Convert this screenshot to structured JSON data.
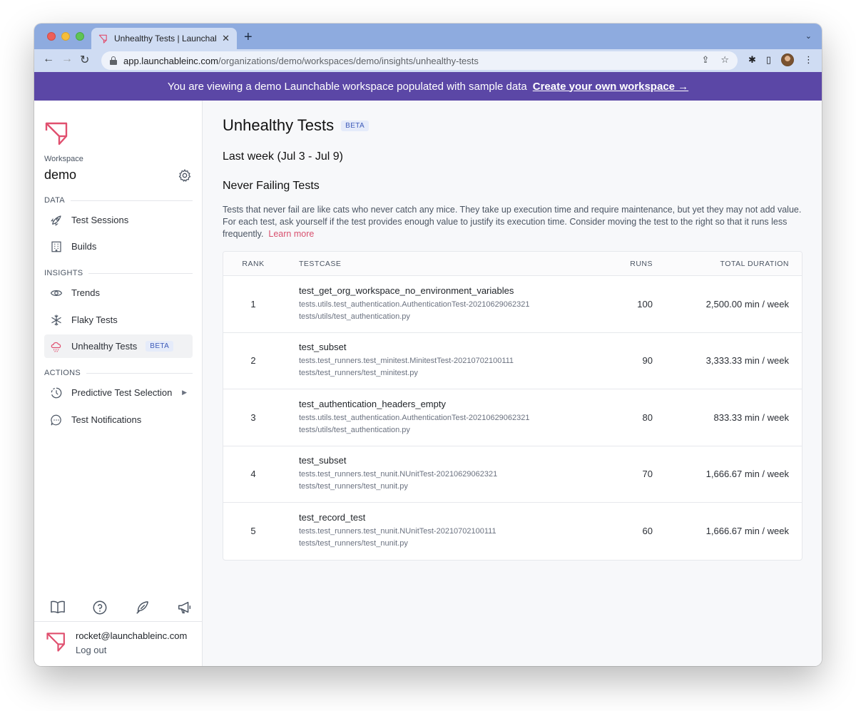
{
  "browser": {
    "tab_title": "Unhealthy Tests | Launchable",
    "new_tab": "+",
    "url_host": "app.launchableinc.com",
    "url_path": "/organizations/demo/workspaces/demo/insights/unhealthy-tests"
  },
  "banner": {
    "text": "You are viewing a demo Launchable workspace populated with sample data",
    "link": "Create your own workspace →"
  },
  "sidebar": {
    "workspace_label": "Workspace",
    "workspace_name": "demo",
    "sections": {
      "data": "DATA",
      "insights": "INSIGHTS",
      "actions": "ACTIONS"
    },
    "items": [
      {
        "label": "Test Sessions",
        "icon": "rocket-icon"
      },
      {
        "label": "Builds",
        "icon": "building-icon"
      },
      {
        "label": "Trends",
        "icon": "eye-icon"
      },
      {
        "label": "Flaky Tests",
        "icon": "snowflake-icon"
      },
      {
        "label": "Unhealthy Tests",
        "icon": "rain-cloud-icon",
        "badge": "BETA",
        "active": true
      },
      {
        "label": "Predictive Test Selection",
        "icon": "clock-dashed-icon",
        "arrow": "▶"
      },
      {
        "label": "Test Notifications",
        "icon": "chat-bubble-icon"
      }
    ],
    "footer": {
      "email": "rocket@launchableinc.com",
      "logout": "Log out"
    }
  },
  "main": {
    "title": "Unhealthy Tests",
    "title_badge": "BETA",
    "period": "Last week (Jul 3 - Jul 9)",
    "section_title": "Never Failing Tests",
    "description": "Tests that never fail are like cats who never catch any mice. They take up execution time and require maintenance, but yet they may not add value. For each test, ask yourself if the test provides enough value to justify its execution time. Consider moving the test to the right so that it runs less frequently.",
    "learn_more": "Learn more",
    "table": {
      "headers": {
        "rank": "RANK",
        "testcase": "TESTCASE",
        "runs": "RUNS",
        "duration": "TOTAL DURATION"
      },
      "rows": [
        {
          "rank": "1",
          "name": "test_get_org_workspace_no_environment_variables",
          "class": "tests.utils.test_authentication.AuthenticationTest-20210629062321",
          "file": "tests/utils/test_authentication.py",
          "runs": "100",
          "duration": "2,500.00 min / week"
        },
        {
          "rank": "2",
          "name": "test_subset",
          "class": "tests.test_runners.test_minitest.MinitestTest-20210702100111",
          "file": "tests/test_runners/test_minitest.py",
          "runs": "90",
          "duration": "3,333.33 min / week"
        },
        {
          "rank": "3",
          "name": "test_authentication_headers_empty",
          "class": "tests.utils.test_authentication.AuthenticationTest-20210629062321",
          "file": "tests/utils/test_authentication.py",
          "runs": "80",
          "duration": "833.33 min / week"
        },
        {
          "rank": "4",
          "name": "test_subset",
          "class": "tests.test_runners.test_nunit.NUnitTest-20210629062321",
          "file": "tests/test_runners/test_nunit.py",
          "runs": "70",
          "duration": "1,666.67 min / week"
        },
        {
          "rank": "5",
          "name": "test_record_test",
          "class": "tests.test_runners.test_nunit.NUnitTest-20210702100111",
          "file": "tests/test_runners/test_nunit.py",
          "runs": "60",
          "duration": "1,666.67 min / week"
        }
      ]
    }
  },
  "colors": {
    "banner": "#5b47a6",
    "brand_red": "#e0506f",
    "beta_bg": "#e5ebfa",
    "beta_text": "#3e5bb8"
  }
}
